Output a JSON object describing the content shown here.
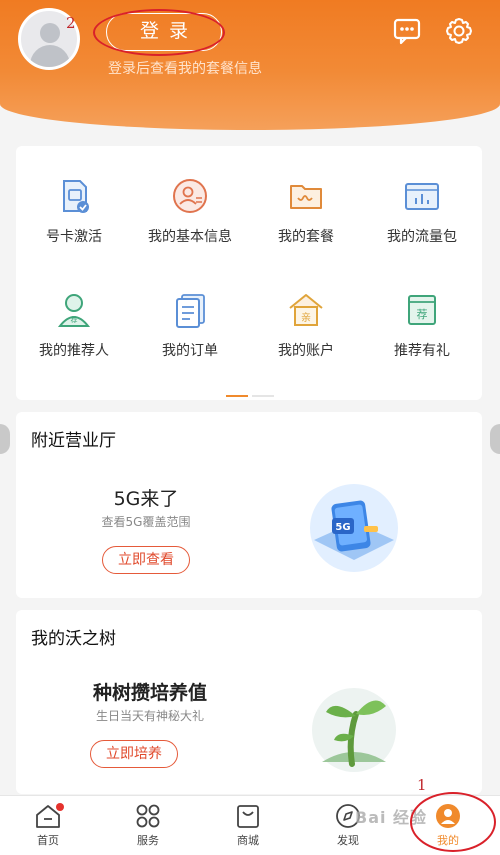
{
  "header": {
    "login_label": "登录",
    "login_hint": "登录后查看我的套餐信息",
    "icons": [
      "message-icon",
      "settings-icon"
    ],
    "accent": "#f07b22"
  },
  "annotations": {
    "login_number": "2",
    "mine_number": "1"
  },
  "service_grid": {
    "items": [
      {
        "label": "号卡激活",
        "icon": "sim-card-icon"
      },
      {
        "label": "我的基本信息",
        "icon": "profile-icon"
      },
      {
        "label": "我的套餐",
        "icon": "package-folder-icon"
      },
      {
        "label": "我的流量包",
        "icon": "data-chart-icon"
      },
      {
        "label": "我的推荐人",
        "icon": "referrer-icon"
      },
      {
        "label": "我的订单",
        "icon": "orders-icon"
      },
      {
        "label": "我的账户",
        "icon": "account-house-icon"
      },
      {
        "label": "推荐有礼",
        "icon": "recommend-gift-icon"
      }
    ],
    "page": 1,
    "pages": 2
  },
  "nearby_store": {
    "title": "附近营业厅",
    "headline": "5G来了",
    "subtext": "查看5G覆盖范围",
    "button": "立即查看",
    "badge": "5G"
  },
  "wo_tree": {
    "title": "我的沃之树",
    "headline": "种树攒培养值",
    "subtext": "生日当天有神秘大礼",
    "button": "立即培养"
  },
  "bottom_nav": {
    "items": [
      {
        "label": "首页",
        "icon": "home-icon"
      },
      {
        "label": "服务",
        "icon": "service-grid-icon"
      },
      {
        "label": "商城",
        "icon": "shopping-bag-icon"
      },
      {
        "label": "发现",
        "icon": "compass-icon"
      },
      {
        "label": "我的",
        "icon": "me-icon"
      }
    ],
    "active": "我的"
  },
  "watermark": "Bai 经验"
}
